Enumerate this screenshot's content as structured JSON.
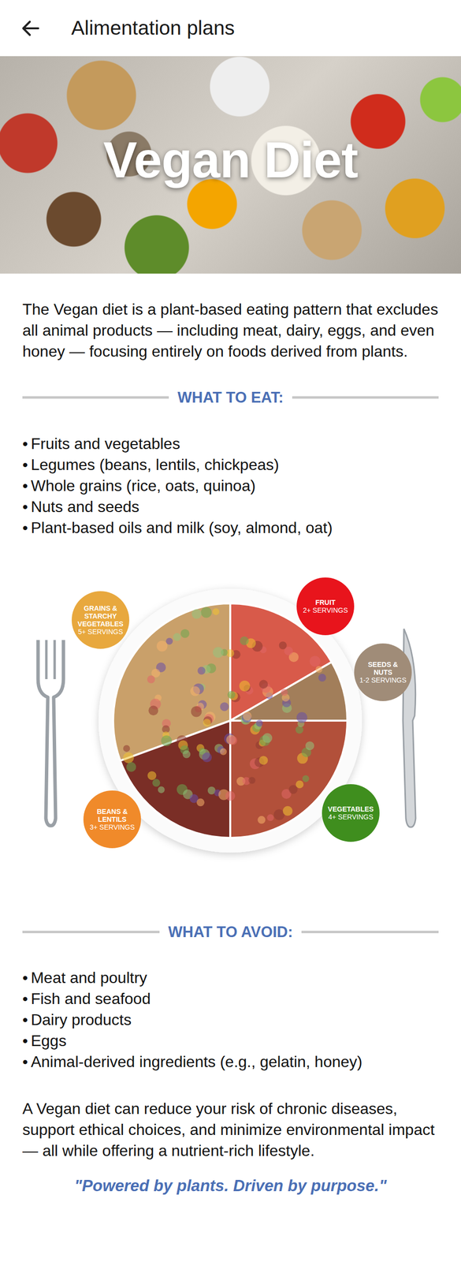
{
  "header": {
    "title": "Alimentation plans"
  },
  "hero": {
    "title": "Vegan Diet"
  },
  "intro": "The Vegan diet is a plant-based eating pattern that excludes all animal products — including meat, dairy, eggs, and even honey — focusing entirely on foods derived from plants.",
  "eat": {
    "heading": "WHAT TO EAT:",
    "bullet": "•",
    "items": [
      "Fruits and vegetables",
      "Legumes (beans, lentils, chickpeas)",
      "Whole grains (rice, oats, quinoa)",
      "Nuts and seeds",
      "Plant-based oils and milk (soy, almond, oat)"
    ]
  },
  "plate": {
    "sections": [
      {
        "label": "GRAINS & STARCHY VEGETABLES",
        "servings": "5+ SERVINGS",
        "color": "#e8a83e"
      },
      {
        "label": "FRUIT",
        "servings": "2+ SERVINGS",
        "color": "#e8141c"
      },
      {
        "label": "SEEDS & NUTS",
        "servings": "1-2 SERVINGS",
        "color": "#a08c78"
      },
      {
        "label": "VEGETABLES",
        "servings": "4+ SERVINGS",
        "color": "#3f8e1e"
      },
      {
        "label": "BEANS & LENTILS",
        "servings": "3+ SERVINGS",
        "color": "#f08a2a"
      }
    ]
  },
  "avoid": {
    "heading": "WHAT TO AVOID:",
    "bullet": "•",
    "items": [
      "Meat and poultry",
      "Fish and seafood",
      "Dairy products",
      "Eggs",
      "Animal-derived ingredients (e.g., gelatin, honey)"
    ]
  },
  "outro": "A Vegan diet can reduce your risk of chronic diseases, support ethical choices, and minimize environmental impact — all while offering a nutrient-rich lifestyle.",
  "quote": "\"Powered by plants. Driven by purpose.\""
}
